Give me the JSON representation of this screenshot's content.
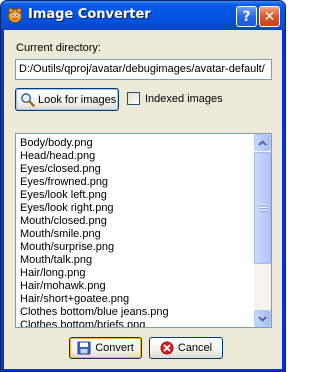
{
  "window": {
    "title": "Image Converter",
    "help_label": "?",
    "close_label": "✕"
  },
  "directory": {
    "label": "Current directory:",
    "path": "D:/Outils/qproj/avatar/debugimages/avatar-default/"
  },
  "look_button": {
    "label": "Look for images"
  },
  "indexed": {
    "label": "Indexed images",
    "checked": false
  },
  "files": [
    "Body/body.png",
    "Head/head.png",
    "Eyes/closed.png",
    "Eyes/frowned.png",
    "Eyes/look left.png",
    "Eyes/look right.png",
    "Mouth/closed.png",
    "Mouth/smile.png",
    "Mouth/surprise.png",
    "Mouth/talk.png",
    "Hair/long.png",
    "Hair/mohawk.png",
    "Hair/short+goatee.png",
    "Clothes bottom/blue jeans.png",
    "Clothes bottom/briefs.png"
  ],
  "buttons": {
    "convert": "Convert",
    "cancel": "Cancel"
  }
}
